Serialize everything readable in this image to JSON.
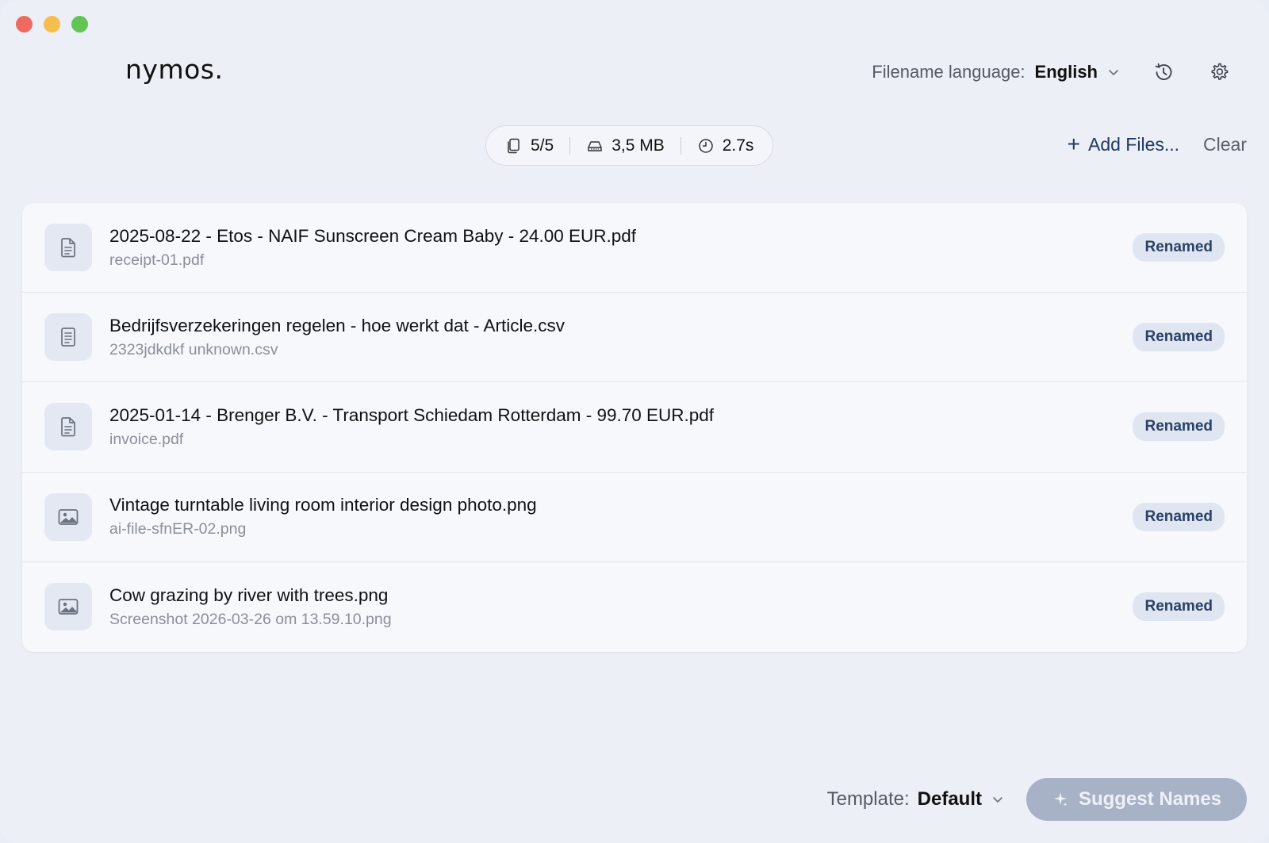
{
  "app": {
    "logo": "nymos."
  },
  "header": {
    "language_label": "Filename language:",
    "language_value": "English",
    "history_icon": "history-icon",
    "settings_icon": "gear-icon"
  },
  "stats": {
    "files": "5/5",
    "size": "3,5 MB",
    "time": "2.7s"
  },
  "actions": {
    "add_files": "Add Files...",
    "clear": "Clear"
  },
  "files": [
    {
      "icon": "document-icon",
      "new_name": "2025-08-22 - Etos - NAIF Sunscreen Cream Baby - 24.00 EUR.pdf",
      "old_name": "receipt-01.pdf",
      "status": "Renamed"
    },
    {
      "icon": "spreadsheet-icon",
      "new_name": "Bedrijfsverzekeringen regelen - hoe werkt dat - Article.csv",
      "old_name": "2323jdkdkf unknown.csv",
      "status": "Renamed"
    },
    {
      "icon": "document-icon",
      "new_name": "2025-01-14 - Brenger B.V. - Transport Schiedam Rotterdam - 99.70 EUR.pdf",
      "old_name": "invoice.pdf",
      "status": "Renamed"
    },
    {
      "icon": "image-icon",
      "new_name": "Vintage turntable living room interior design photo.png",
      "old_name": "ai-file-sfnER-02.png",
      "status": "Renamed"
    },
    {
      "icon": "image-icon",
      "new_name": "Cow grazing by river with trees.png",
      "old_name": "Screenshot 2026-03-26 om 13.59.10.png",
      "status": "Renamed"
    }
  ],
  "footer": {
    "template_label": "Template:",
    "template_value": "Default",
    "suggest_button": "Suggest Names"
  },
  "colors": {
    "accent": "#1e3a64",
    "badge_bg": "#dfe6f1",
    "button_disabled": "#a7b2c7",
    "window_bg": "#eceff6"
  }
}
